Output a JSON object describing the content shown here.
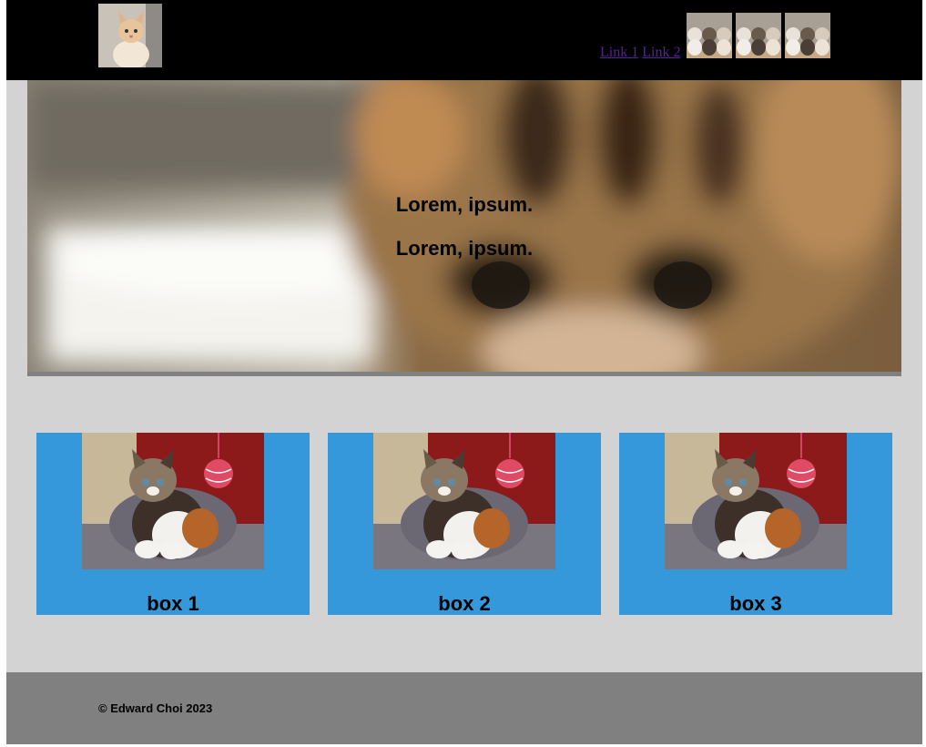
{
  "header": {
    "logo_icon": "kitten-photo-icon",
    "nav": [
      "Link 1",
      "Link 2"
    ],
    "thumbnails": [
      "kittens-thumbnail-icon",
      "kittens-thumbnail-icon",
      "kittens-thumbnail-icon"
    ]
  },
  "hero": {
    "line1": "Lorem, ipsum.",
    "line2": "Lorem, ipsum."
  },
  "boxes": [
    {
      "label": "box 1"
    },
    {
      "label": "box 2"
    },
    {
      "label": "box 3"
    }
  ],
  "footer": {
    "copyright": "© Edward Choi 2023"
  },
  "colors": {
    "header_bg": "#000000",
    "page_bg": "#d3d3d3",
    "box_bg": "#3498db",
    "footer_bg": "#808080",
    "link": "#5a1fa0"
  }
}
